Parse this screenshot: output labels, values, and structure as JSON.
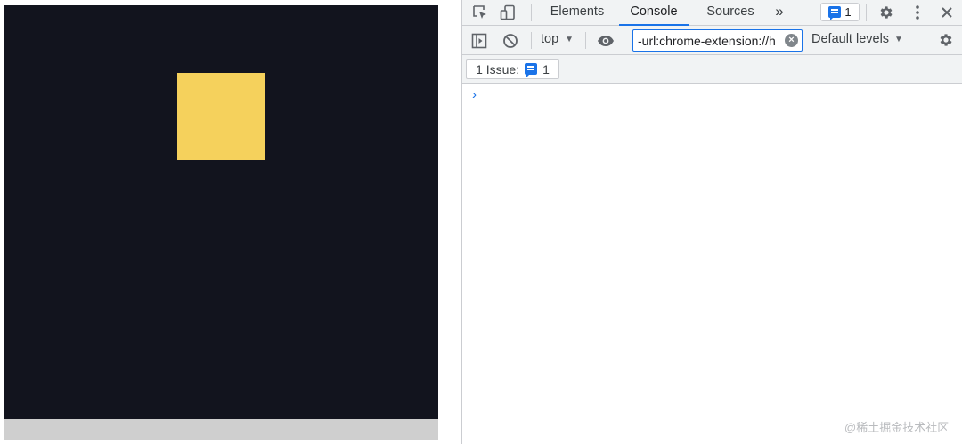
{
  "page": {
    "square_color": "#f5d15c",
    "viewport_color": "#12141e"
  },
  "devtools": {
    "tabs": [
      {
        "label": "Elements",
        "active": false
      },
      {
        "label": "Console",
        "active": true
      },
      {
        "label": "Sources",
        "active": false
      }
    ],
    "more_tabs_glyph": "»",
    "messages_count": "1",
    "context": "top",
    "filter": {
      "value": "-url:chrome-extension://h",
      "placeholder": "Filter"
    },
    "log_levels": "Default levels",
    "issues": {
      "label": "1 Issue:",
      "count": "1"
    },
    "prompt_glyph": "›",
    "accent": "#1a73e8"
  },
  "watermark": "@稀土掘金技术社区"
}
